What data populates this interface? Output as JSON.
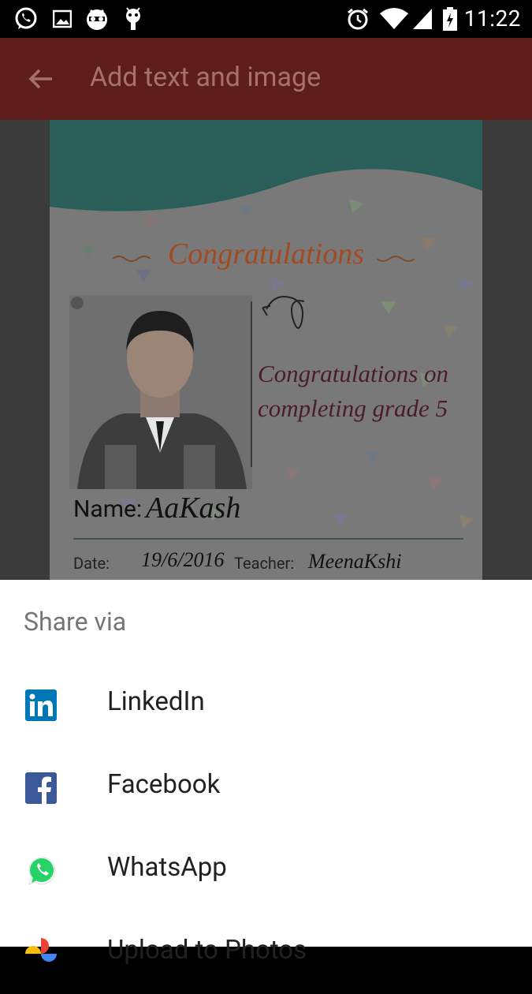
{
  "status_bar": {
    "icons": [
      "whatsapp-icon",
      "image-icon",
      "incognito-icon",
      "bug-icon",
      "alarm-icon",
      "wifi-icon",
      "signal-icon",
      "battery-icon"
    ],
    "time": "11:22"
  },
  "app_bar": {
    "title": "Add text and image",
    "back_icon": "back-arrow-icon"
  },
  "card": {
    "title": "Congratulations",
    "message_line1": "Congratulations on",
    "message_line2": "completing grade 5",
    "name_label": "Name:",
    "name_value": "AaKash",
    "date_label": "Date:",
    "date_value": "19/6/2016",
    "teacher_label": "Teacher:",
    "teacher_value": "MeenaKshi",
    "colors": {
      "teal": "#2a5e58",
      "title": "#a34a22",
      "message": "#4b1b2e"
    }
  },
  "share_sheet": {
    "title": "Share via",
    "items": [
      {
        "label": "LinkedIn",
        "icon": "linkedin-icon",
        "color": "#0077b5"
      },
      {
        "label": "Facebook",
        "icon": "facebook-icon",
        "color": "#3b5998"
      },
      {
        "label": "WhatsApp",
        "icon": "whatsapp-icon",
        "color": "#25d366"
      },
      {
        "label": "Upload to Photos",
        "icon": "photos-icon",
        "color": "#ea4335"
      }
    ]
  }
}
